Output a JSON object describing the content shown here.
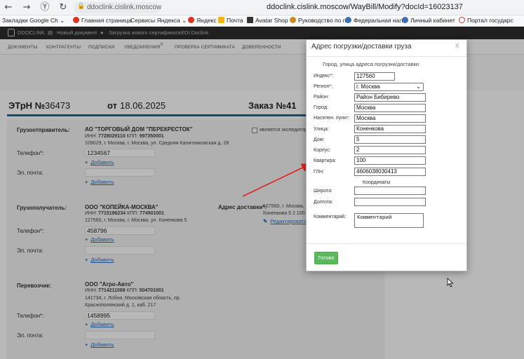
{
  "browser": {
    "back_icon": "←",
    "forward_icon": "→",
    "yandex_icon": "Ⓨ",
    "reload_icon": "↻",
    "lock_icon": "🔒",
    "host": "ddoclink.cislink.moscow",
    "url": "ddoclink.cislink.moscow/WayBill/Modify?docId=16023137",
    "bookmarks": [
      "Закладки Google Ch ⌄",
      "Главная страница",
      "Сервисы Яндекса ⌄",
      "Яндекс",
      "Почта",
      "Avatar Shop",
      "Руководство по п",
      "Федеральная нал",
      "Личный кабинет",
      "Портал государс"
    ]
  },
  "site_top": {
    "brand": "DDOCLINK",
    "new_doc": "Новый документ",
    "upload_cert": "Загрузка нового сертификата",
    "edi": "EDI.Doclink"
  },
  "menu": [
    "ДОКУМЕНТЫ",
    "КОНТРАГЕНТЫ",
    "ПОДПИСКИ",
    "УВЕДОМЛЕНИЯ",
    "ПРОВЕРКА СЕРТИФИКАТА",
    "ДОВЕРЕННОСТИ"
  ],
  "notifications_badge": "0",
  "doc": {
    "type_label": "ЭТрН №",
    "number": "36473",
    "date_label": "от",
    "date": "18.06.2025",
    "order_label": "Заказ №",
    "order_number": "41"
  },
  "shipper": {
    "label": "Грузоотправитель:",
    "name": "АО \"ТОРГОВЫЙ ДОМ \"ПЕРЕКРЕСТОК\"",
    "inn_label": "ИНН:",
    "inn": "7728029110",
    "kpp_label": "КПП:",
    "kpp": "997350001",
    "address": "109029, г. Москва, г. Москва, ул. Средняя Калитниковская д. 28",
    "expeditor_label": "является экспедитор",
    "phone_label": "Телефон*:",
    "phone": "1234567",
    "add_label": "Добавить",
    "email_label": "Эл. почта:"
  },
  "consignee": {
    "label": "Грузополучатель:",
    "name": "ООО \"КОПЕЙКА-МОСКВА\"",
    "inn_label": "ИНН:",
    "inn": "7715196234",
    "kpp_label": "КПП:",
    "kpp": "774901001",
    "address": "127560, г. Москва, г. Москва, ул. Коненкова 5",
    "delivery_label": "Адрес доставки*:",
    "delivery_line1": "127560, г. Москва,",
    "delivery_line2": "Коненкова 5 2 100",
    "edit_label": "Редактировать",
    "phone_label": "Телефон*:",
    "phone": "458796",
    "add_label": "Добавить",
    "email_label": "Эл. почта:"
  },
  "carrier": {
    "label": "Перевозчик:",
    "name": "ООО \"Агро-Авто\"",
    "inn_label": "ИНН:",
    "inn": "7714211088",
    "kpp_label": "КПП:",
    "kpp": "504701001",
    "address1": "141734, г. Лобня, Московская область, пр.",
    "address2": "Краснополянский д. 1, каб. 217",
    "phone_label": "Телефон*:",
    "phone": "1458995",
    "add_label": "Добавить",
    "email_label": "Эл. почта:"
  },
  "modal": {
    "title": "Адрес погрузки/доставки груза",
    "close": "x",
    "subtitle": "Город, улица адреса погрузки/доставки",
    "fields": {
      "index": {
        "label": "Индекс*:",
        "value": "127560"
      },
      "region": {
        "label": "Регион*:",
        "value": "г. Москва"
      },
      "district": {
        "label": "Район:",
        "value": "Район Бибирево"
      },
      "city": {
        "label": "Город:",
        "value": "Москва"
      },
      "settlement": {
        "label": "Населен. пункт:",
        "value": "Москва"
      },
      "street": {
        "label": "Улица:",
        "value": "Коненкова"
      },
      "house": {
        "label": "Дом:",
        "value": "5"
      },
      "building": {
        "label": "Корпус:",
        "value": "2"
      },
      "flat": {
        "label": "Квартира:",
        "value": "100"
      },
      "gln": {
        "label": "ГЛН:",
        "value": "4606038030413"
      }
    },
    "coords_title": "Координаты",
    "latitude_label": "Широта:",
    "longitude_label": "Долгота:",
    "comment_label": "Комментарий:",
    "comment_value": "Комментарий",
    "done_label": "Готово"
  },
  "colors": {
    "accent_blue": "#2f5f9e",
    "link_blue": "#2a6ebb",
    "done_green": "#5cb85c",
    "arrow_red": "#e02020"
  }
}
